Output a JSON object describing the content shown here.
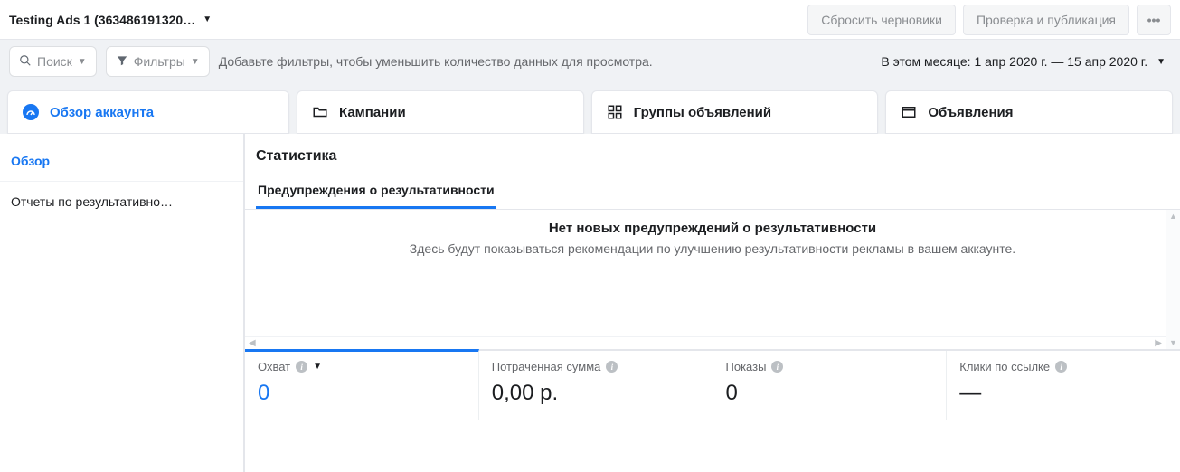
{
  "topbar": {
    "account_label": "Testing Ads 1 (363486191320…",
    "reset_drafts": "Сбросить черновики",
    "review_publish": "Проверка и публикация",
    "more": "•••"
  },
  "filterbar": {
    "search_label": "Поиск",
    "filters_label": "Фильтры",
    "hint": "Добавьте фильтры, чтобы уменьшить количество данных для просмотра.",
    "date_range": "В этом месяце: 1 апр 2020 г. — 15 апр 2020 г."
  },
  "tabs": {
    "overview": "Обзор аккаунта",
    "campaigns": "Кампании",
    "adsets": "Группы объявлений",
    "ads": "Объявления"
  },
  "sidebar": {
    "items": [
      {
        "label": "Обзор"
      },
      {
        "label": "Отчеты по результативно…"
      }
    ]
  },
  "panel": {
    "title": "Статистика",
    "subtab": "Предупреждения о результативности",
    "alerts_heading": "Нет новых предупреждений о результативности",
    "alerts_body": "Здесь будут показываться рекомендации по улучшению результативности рекламы в вашем аккаунте."
  },
  "metrics": [
    {
      "label": "Охват",
      "value": "0",
      "active": true
    },
    {
      "label": "Потраченная сумма",
      "value": "0,00 р."
    },
    {
      "label": "Показы",
      "value": "0"
    },
    {
      "label": "Клики по ссылке",
      "value": "—"
    }
  ]
}
